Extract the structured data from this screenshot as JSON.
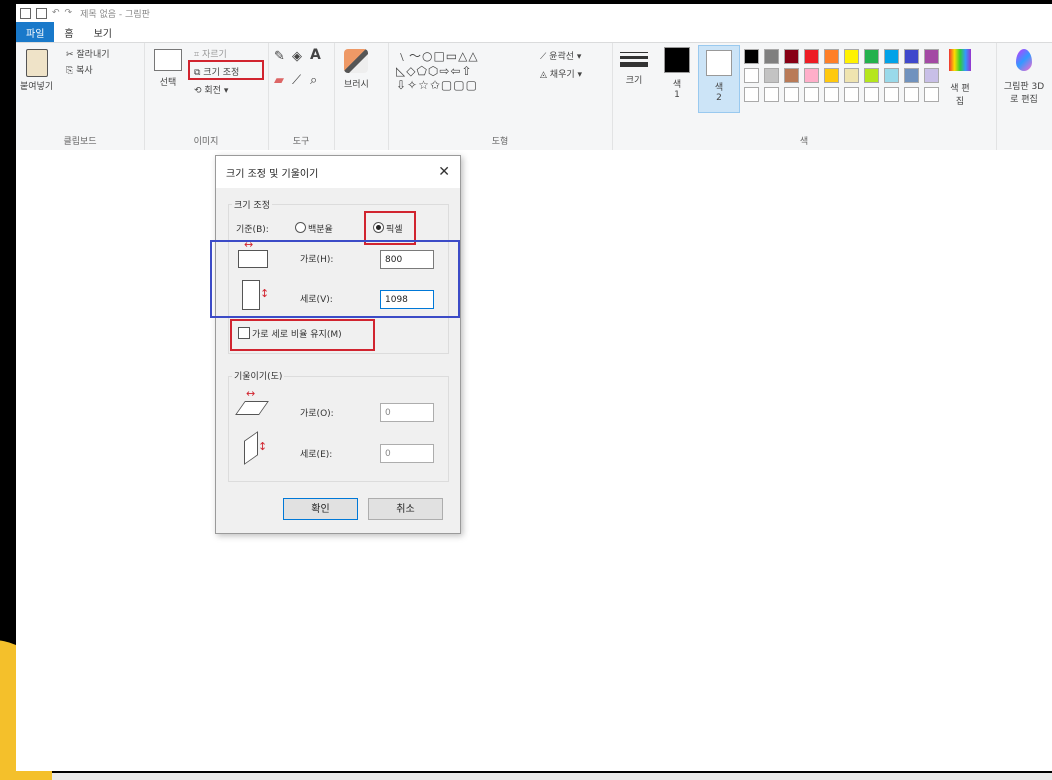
{
  "window": {
    "title": "제목 없음 - 그림판"
  },
  "tabs": [
    {
      "label": "파일"
    },
    {
      "label": "홈"
    },
    {
      "label": "보기"
    }
  ],
  "ribbon": {
    "clipboard": {
      "paste": "붙여넣기",
      "cut": "잘라내기",
      "copy": "복사",
      "group": "클립보드"
    },
    "image": {
      "select": "선택",
      "crop": "자르기",
      "resize": "크기 조정",
      "rotate": "회전 ▾",
      "group": "이미지"
    },
    "tools": {
      "group": "도구",
      "text_icon": "A"
    },
    "brush": {
      "label": "브러시"
    },
    "shapes": {
      "outline": "윤곽선 ▾",
      "fill": "채우기 ▾",
      "group": "도형"
    },
    "size": {
      "label": "크기"
    },
    "color1": {
      "label": "색",
      "num": "1"
    },
    "color2": {
      "label": "색",
      "num": "2"
    },
    "colors": {
      "group": "색",
      "edit": "색 편집"
    },
    "paint3d": {
      "label": "그림판 3D로 편집"
    },
    "palette": [
      "#000000",
      "#7f7f7f",
      "#880015",
      "#ed1c24",
      "#ff7f27",
      "#fff200",
      "#22b14c",
      "#00a2e8",
      "#3f48cc",
      "#a349a4",
      "#ffffff",
      "#c3c3c3",
      "#b97a57",
      "#ffaec9",
      "#ffc90e",
      "#efe4b0",
      "#b5e61d",
      "#99d9ea",
      "#7092be",
      "#c8bfe7"
    ]
  },
  "dialog": {
    "title": "크기 조정 및 기울이기",
    "close": "✕",
    "resize_group": "크기 조정",
    "basis_label": "기준(B):",
    "percent": "백분율",
    "pixels": "픽셀",
    "width_label": "가로(H):",
    "width_value": "800",
    "height_label": "세로(V):",
    "height_value": "1098",
    "keep_ratio": "가로 세로 비율 유지(M)",
    "skew_group": "기울이기(도)",
    "skew_h_label": "가로(O):",
    "skew_h_value": "0",
    "skew_v_label": "세로(E):",
    "skew_v_value": "0",
    "ok": "확인",
    "cancel": "취소"
  },
  "colors": {
    "accent": "#1979ca",
    "highlight_red": "#d1242f",
    "highlight_blue": "#3c4bc7",
    "frame_yellow": "#f4c02b"
  }
}
